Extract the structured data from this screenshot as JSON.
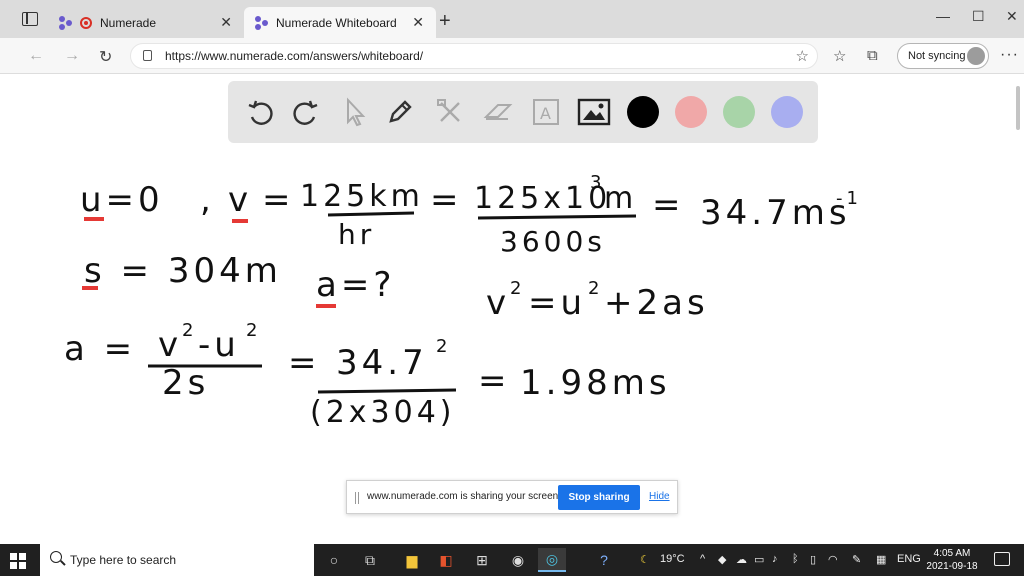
{
  "browser": {
    "tabs": [
      {
        "label": "Numerade",
        "active": false
      },
      {
        "label": "Numerade Whiteboard",
        "active": true
      }
    ],
    "url": "https://www.numerade.com/answers/whiteboard/",
    "sync_label": "Not syncing"
  },
  "whiteboard": {
    "tools": [
      "undo-icon",
      "redo-icon",
      "pointer-icon",
      "pen-icon",
      "tools-icon",
      "eraser-icon",
      "text-icon",
      "image-icon"
    ],
    "colors": [
      "#000000",
      "#f0a8a8",
      "#a8d4a8",
      "#a8aef0"
    ],
    "handwriting": {
      "line1": {
        "u0": "u=0",
        "comma": ",",
        "v_label": "v",
        "eq1": "=",
        "v_num": "125km",
        "v_den": "hr",
        "eq2": "=",
        "num2": "125x10",
        "exp3": "3",
        "num2_unit": "m",
        "den2": "3600s",
        "eq3": "=",
        "result1": "34.7ms",
        "result1_exp": "-1"
      },
      "line2": {
        "s": "s = 304m",
        "a": "a=?",
        "formula": "v",
        "f_exp1": "2",
        "formula_mid": "=u",
        "f_exp2": "2",
        "formula_end": "+2as"
      },
      "line3": {
        "a_eq": "a =",
        "frac1_num": "v",
        "frac1_e1": "2",
        "frac1_minus": "-u",
        "frac1_e2": "2",
        "frac1_den": "2s",
        "eq2": "=",
        "frac2_num": "34.7",
        "frac2_e": "2",
        "frac2_den": "(2x304)",
        "eq3": "=",
        "result": "1.98ms"
      }
    }
  },
  "share_bar": {
    "message": "www.numerade.com is sharing your screen.",
    "stop_label": "Stop sharing",
    "hide_label": "Hide"
  },
  "taskbar": {
    "search_placeholder": "Type here to search",
    "weather": "19°C",
    "language": "ENG",
    "time": "4:05 AM",
    "date": "2021-09-18"
  }
}
